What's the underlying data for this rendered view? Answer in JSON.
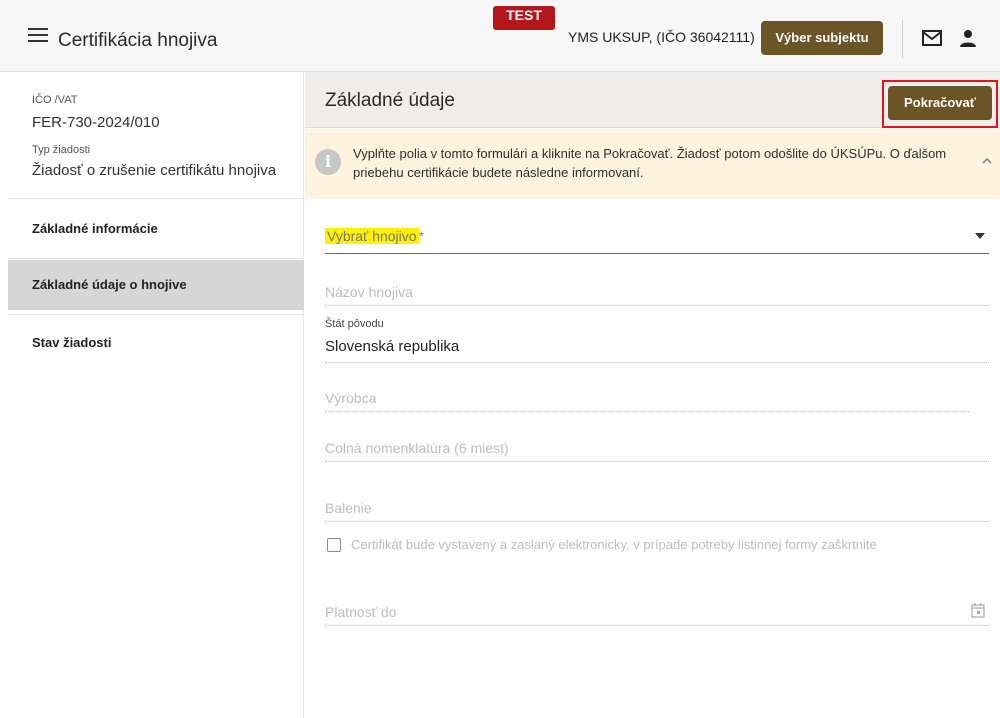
{
  "header": {
    "app_title": "Certifikácia hnojiva",
    "test_badge": "TEST",
    "subject": "YMS UKSUP, (IČO 36042111)",
    "subject_button": "Výber subjektu",
    "icons": [
      "menu-icon",
      "mail-icon",
      "person-icon"
    ]
  },
  "sidebar": {
    "ico_label": "IČO /VAT",
    "ico_value": "FER-730-2024/010",
    "type_label": "Typ žiadosti",
    "type_value": "Žiadosť o zrušenie certifikátu hnojiva",
    "nav": [
      {
        "label": "Základné informácie",
        "active": false
      },
      {
        "label": "Základné údaje o hnojive",
        "active": true
      },
      {
        "label": "Stav žiadosti",
        "active": false
      }
    ]
  },
  "main": {
    "title": "Základné údaje",
    "continue_button": "Pokračovať",
    "info_text": "Vyplňte polia v tomto formulári a kliknite na Pokračovať. Žiadosť potom odošlite do ÚKSÚPu. O ďalšom priebehu certifikácie budete následne informovaní.",
    "form": {
      "select_fertilizer": "Vybrať hnojivo",
      "required_mark": "*",
      "fertilizer_name": "Názov hnojiva",
      "country_label": "Štát pôvodu",
      "country_value": "Slovenská republika",
      "producer": "Výrobca",
      "customs_nomenclature": "Colná nomenklatúra (6 miest)",
      "packaging": "Balenie",
      "checkbox_label": "Certifikát bude vystavený a zaslaný elektronicky, v prípade potreby listinnej formy zaškrtnite",
      "checkbox_checked": false,
      "valid_until": "Platnosť do"
    }
  },
  "colors": {
    "brand_button": "#6b5426",
    "test_badge": "#b3161b",
    "highlight_outline": "#e5141b",
    "info_background": "#fdf3de",
    "active_nav": "#d6d6d6",
    "label_highlight": "#fff200"
  }
}
